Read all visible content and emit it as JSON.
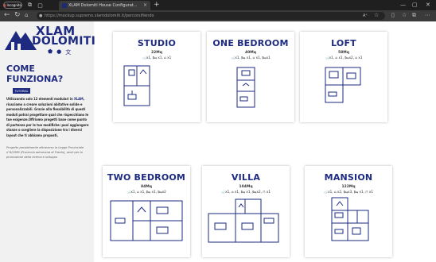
{
  "browser": {
    "profile_label": "Incognito",
    "tab_title": "XLAM Dolomiti House Configurat...",
    "url": "https://mockup.supremo.xlamdolomiti.it/percorsifiendo"
  },
  "brand": {
    "logo_top": "XLAM",
    "logo_bottom": "DOLOMITI",
    "primary_color": "#1d2a80"
  },
  "sidebar": {
    "heading_line1": "COME",
    "heading_line2": "FUNZIONA?",
    "tutorial_label": "TUTORIAL",
    "intro_before": "Utilizzando solo 12 elementi modulari in ",
    "intro_highlight": "XLAM",
    "intro_after": ", riusciamo a creare soluzioni abitative solide e personalizzabili. Grazie alla flessibilità di questi moduli potrai progettare qual che rispecchiano le tue esigenze.Offriamo progetti base come punto di partenza per le tue modifiche: puoi aggiungere stanze o scegliere la disposizione tra i diversi layout che ti abbiamo proposti.",
    "note": "Progetto parzialmente attraverso la Legge Provinciale n°6/1999 (Provincia autonoma di Trento), avvii per la promozione della ricerca e sviluppo"
  },
  "cards": [
    {
      "title": "STUDIO",
      "size": "22Mq",
      "modules": "🛁x1, 🛏 x1, ⌂ x1"
    },
    {
      "title": "ONE BEDROOM",
      "size": "40Mq",
      "modules": "🛁x1, 🛏 x1, ⌂ x1, 🛏x1"
    },
    {
      "title": "LOFT",
      "size": "58Mq",
      "modules": "🛁x1, ⌂ x1, 🛏x2, ⌂ x1"
    },
    {
      "title": "TWO BEDROOM",
      "size": "84Mq",
      "modules": "🛁x1, ⌂ x1, 🛏 x1, 🛏x2"
    },
    {
      "title": "VILLA",
      "size": "104Mq",
      "modules": "🛁x1, ⌂ x1, 🛏 x1, 🛏x2, ⊓ x1"
    },
    {
      "title": "MANSION",
      "size": "122Mq",
      "modules": "🛁x1, ⌂ x2, 🛏x3, 🛏 x1, ⊓ x1"
    }
  ]
}
